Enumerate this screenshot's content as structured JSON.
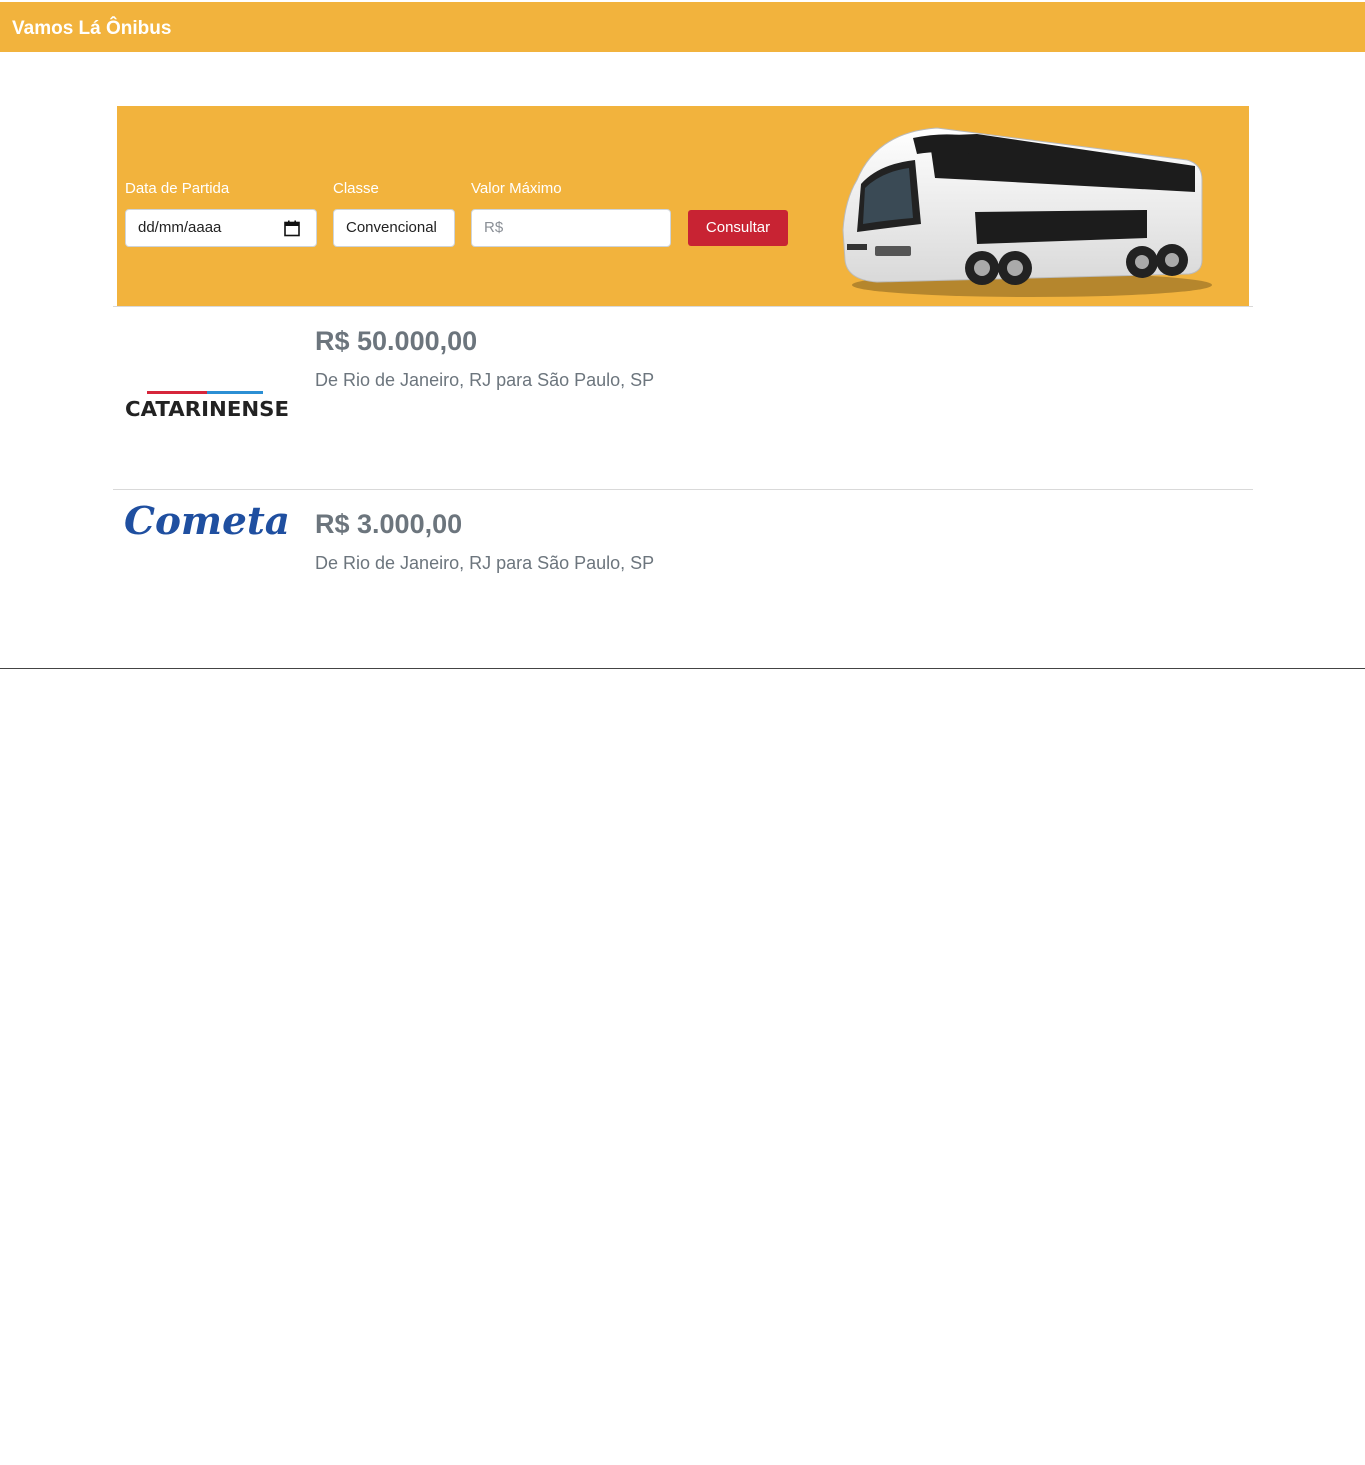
{
  "navbar": {
    "brand": "Vamos Lá Ônibus",
    "color": "#f2b33d"
  },
  "search": {
    "date_label": "Data de Partida",
    "date_value": "dd/mm/aaaa",
    "class_label": "Classe",
    "class_value": "Convencional",
    "max_value_label": "Valor Máximo",
    "max_value_placeholder": "R$",
    "submit_label": "Consultar",
    "submit_color": "#c82333"
  },
  "results": [
    {
      "company_logo_text": "CATARINENSE",
      "price": "R$ 50.000,00",
      "route": "De Rio de Janeiro, RJ para São Paulo, SP"
    },
    {
      "company_logo_text": "Cometa",
      "price": "R$ 3.000,00",
      "route": "De Rio de Janeiro, RJ para São Paulo, SP"
    }
  ]
}
